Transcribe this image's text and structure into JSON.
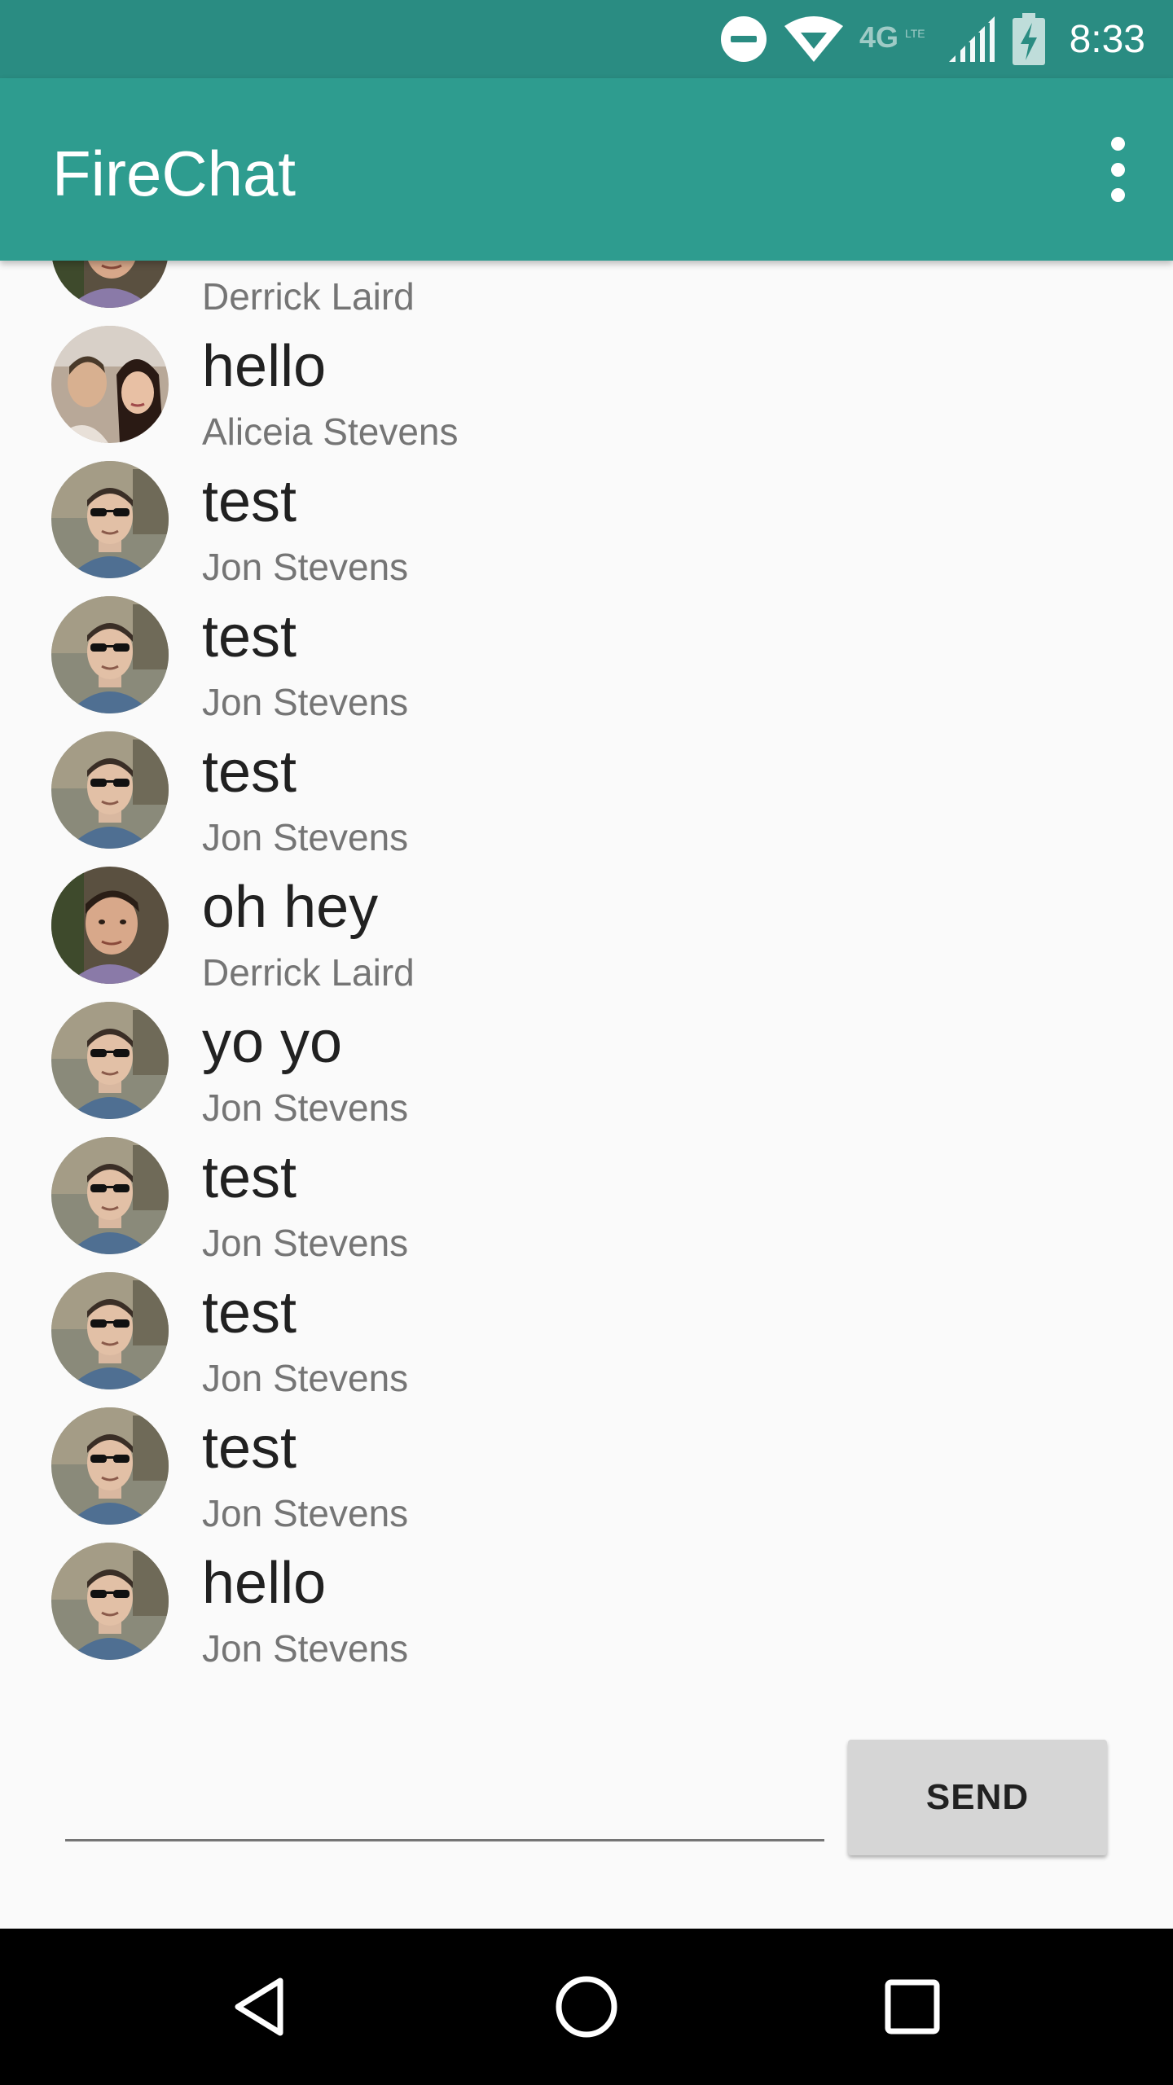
{
  "status_bar": {
    "network": "4G LTE",
    "time": "8:33"
  },
  "app_bar": {
    "title": "FireChat",
    "menu_icon": "more-vert-icon"
  },
  "messages": [
    {
      "text": "",
      "name": "Derrick Laird",
      "avatar": "derrick"
    },
    {
      "text": "hello",
      "name": "Aliceia Stevens",
      "avatar": "aliceia"
    },
    {
      "text": "test",
      "name": "Jon Stevens",
      "avatar": "jon"
    },
    {
      "text": "test",
      "name": "Jon Stevens",
      "avatar": "jon"
    },
    {
      "text": "test",
      "name": "Jon Stevens",
      "avatar": "jon"
    },
    {
      "text": "oh hey",
      "name": "Derrick Laird",
      "avatar": "derrick"
    },
    {
      "text": "yo yo",
      "name": "Jon Stevens",
      "avatar": "jon"
    },
    {
      "text": "test",
      "name": "Jon Stevens",
      "avatar": "jon"
    },
    {
      "text": "test",
      "name": "Jon Stevens",
      "avatar": "jon"
    },
    {
      "text": "test",
      "name": "Jon Stevens",
      "avatar": "jon"
    },
    {
      "text": "hello",
      "name": "Jon Stevens",
      "avatar": "jon"
    }
  ],
  "composer": {
    "input_value": "",
    "send_label": "SEND"
  },
  "nav_bar": {
    "back_icon": "back-triangle-icon",
    "home_icon": "home-circle-icon",
    "recents_icon": "recents-square-icon"
  },
  "colors": {
    "status_bar": "#2a8c82",
    "app_bar": "#2e9c8f",
    "background": "#fafafa",
    "send_button": "#d6d6d6"
  }
}
